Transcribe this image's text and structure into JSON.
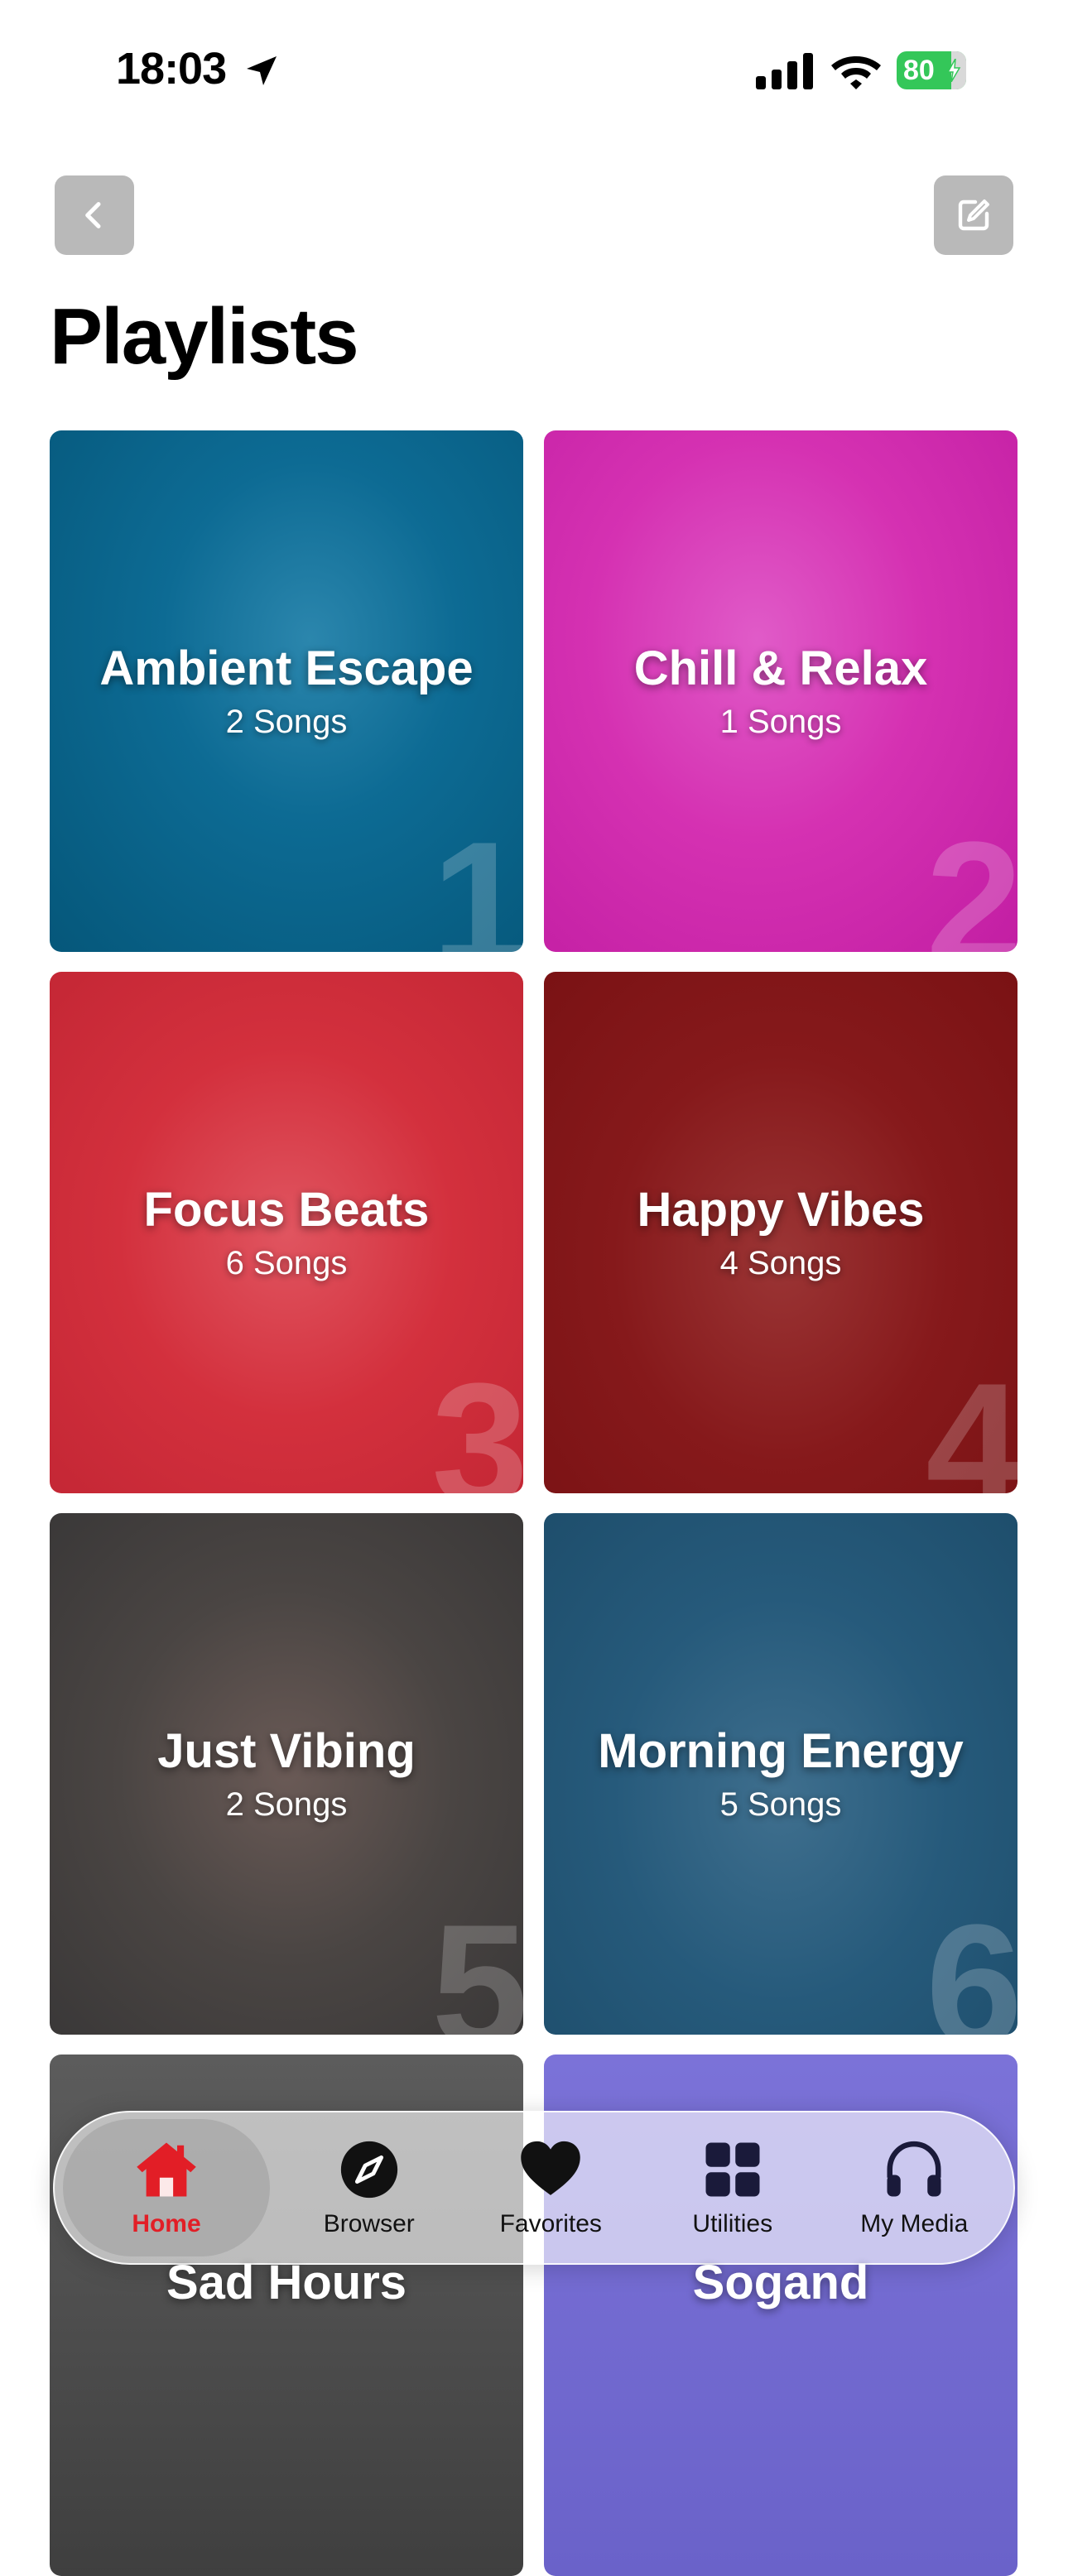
{
  "status_bar": {
    "time": "18:03",
    "battery": "80"
  },
  "header": {
    "title": "Playlists"
  },
  "playlists": [
    {
      "title": "Ambient Escape",
      "count": "2 Songs",
      "number": "1"
    },
    {
      "title": "Chill & Relax",
      "count": "1 Songs",
      "number": "2"
    },
    {
      "title": "Focus Beats",
      "count": "6 Songs",
      "number": "3"
    },
    {
      "title": "Happy Vibes",
      "count": "4 Songs",
      "number": "4"
    },
    {
      "title": "Just Vibing",
      "count": "2 Songs",
      "number": "5"
    },
    {
      "title": "Morning Energy",
      "count": "5 Songs",
      "number": "6"
    },
    {
      "title": "Sad Hours"
    },
    {
      "title": "Sogand"
    }
  ],
  "tabs": [
    {
      "label": "Home",
      "icon": "house-icon",
      "active": true
    },
    {
      "label": "Browser",
      "icon": "compass-icon"
    },
    {
      "label": "Favorites",
      "icon": "heart-icon"
    },
    {
      "label": "Utilities",
      "icon": "grid-icon"
    },
    {
      "label": "My Media",
      "icon": "headphones-icon"
    }
  ],
  "colors": {
    "accent": "#e21e26",
    "battery": "#34c759"
  }
}
